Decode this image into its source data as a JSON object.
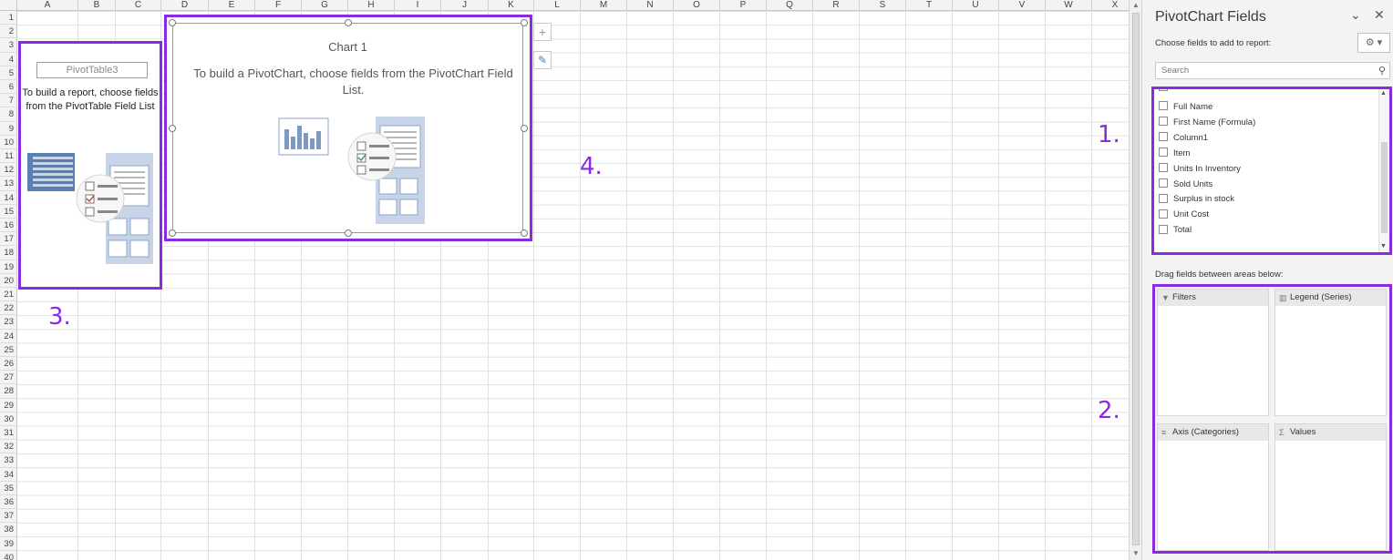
{
  "sheet": {
    "columns": [
      "A",
      "B",
      "C",
      "D",
      "E",
      "F",
      "G",
      "H",
      "I",
      "J",
      "K",
      "L",
      "M",
      "N",
      "O",
      "P",
      "Q",
      "R",
      "S",
      "T",
      "U",
      "V",
      "W",
      "X"
    ],
    "rows": [
      "1",
      "2",
      "3",
      "4",
      "5",
      "6",
      "7",
      "8",
      "9",
      "10",
      "11",
      "12",
      "13",
      "14",
      "15",
      "16",
      "17",
      "18",
      "19",
      "20",
      "21",
      "22",
      "23",
      "24",
      "25",
      "26",
      "27",
      "28",
      "29",
      "30",
      "31",
      "32",
      "33",
      "34",
      "35",
      "36",
      "37",
      "38",
      "39",
      "40"
    ]
  },
  "pivot_table": {
    "name": "PivotTable3",
    "message": "To build a report, choose fields from the PivotTable Field List"
  },
  "chart": {
    "title": "Chart 1",
    "message": "To build a PivotChart, choose fields from the PivotChart Field List."
  },
  "chart_buttons": {
    "elements": "+",
    "styles": "✎"
  },
  "callouts": {
    "one": "1.",
    "two": "2.",
    "three": "3.",
    "four": "4."
  },
  "pane": {
    "title": "PivotChart Fields",
    "close": "✕",
    "options": "⌄",
    "subtitle": "Choose fields to add to report:",
    "tools_label": "⚙ ▾",
    "search_placeholder": "Search",
    "fields": [
      "Full Name",
      "First Name (Formula)",
      "Column1",
      "Item",
      "Units In Inventory",
      "Sold Units",
      "Surplus in stock",
      "Unit Cost",
      "Total"
    ],
    "drag_label": "Drag fields between areas below:",
    "areas": {
      "filters": "Filters",
      "legend": "Legend (Series)",
      "axis": "Axis (Categories)",
      "values": "Values"
    }
  },
  "colors": {
    "highlight": "#8a2be2"
  }
}
